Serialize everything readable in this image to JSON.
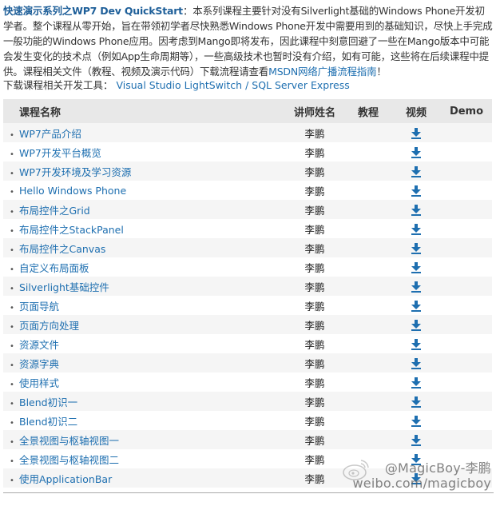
{
  "intro": {
    "lead_title": "快速演示系列之WP7 Dev QuickStart",
    "lead_colon": "：",
    "body": "本系列课程主要针对没有Silverlight基础的Windows Phone开发初学者。整个课程从零开始，旨在带领初学者尽快熟悉Windows Phone开发中需要用到的基础知识，尽快上手完成一般功能的Windows Phone应用。因考虑到Mango即将发布，因此课程中刻意回避了一些在Mango版本中可能会发生变化的技术点（例如App生命周期等），一些高级技术也暂时没有介绍，如有可能，这些将在后续课程中提供。课程相关文件（教程、视频及演示代码）下载流程请查看",
    "guide_link": "MSDN网络广播流程指南",
    "end_mark": "！"
  },
  "tools": {
    "label": "下载课程相关开发工具：",
    "link1": "Visual Studio LightSwitch",
    "separator": " / ",
    "link2": "SQL Server Express"
  },
  "table": {
    "headers": {
      "name": "课程名称",
      "lecturer": "讲师姓名",
      "tutorial": "教程",
      "video": "视频",
      "demo": "Demo"
    },
    "bullet": "•",
    "download_icon": "download-arrow-icon",
    "accent_color": "#1e6fb0",
    "rows": [
      {
        "name": "WP7产品介绍",
        "lecturer": "李鹏",
        "video": true
      },
      {
        "name": "WP7开发平台概览",
        "lecturer": "李鹏",
        "video": true
      },
      {
        "name": "WP7开发环境及学习资源",
        "lecturer": "李鹏",
        "video": true
      },
      {
        "name": "Hello Windows Phone",
        "lecturer": "李鹏",
        "video": true
      },
      {
        "name": "布局控件之Grid",
        "lecturer": "李鹏",
        "video": true
      },
      {
        "name": "布局控件之StackPanel",
        "lecturer": "李鹏",
        "video": true
      },
      {
        "name": "布局控件之Canvas",
        "lecturer": "李鹏",
        "video": true
      },
      {
        "name": "自定义布局面板",
        "lecturer": "李鹏",
        "video": true
      },
      {
        "name": "Silverlight基础控件",
        "lecturer": "李鹏",
        "video": true
      },
      {
        "name": "页面导航",
        "lecturer": "李鹏",
        "video": true
      },
      {
        "name": "页面方向处理",
        "lecturer": "李鹏",
        "video": true
      },
      {
        "name": "资源文件",
        "lecturer": "李鹏",
        "video": true
      },
      {
        "name": "资源字典",
        "lecturer": "李鹏",
        "video": true
      },
      {
        "name": "使用样式",
        "lecturer": "李鹏",
        "video": true
      },
      {
        "name": "Blend初识一",
        "lecturer": "李鹏",
        "video": true
      },
      {
        "name": "Blend初识二",
        "lecturer": "李鹏",
        "video": true
      },
      {
        "name": "全景视图与枢轴视图一",
        "lecturer": "李鹏",
        "video": true
      },
      {
        "name": "全景视图与枢轴视图二",
        "lecturer": "李鹏",
        "video": true
      },
      {
        "name": "使用ApplicationBar",
        "lecturer": "李鹏",
        "video": true
      }
    ]
  },
  "watermark": {
    "handle": "@MagicBoy-李鹏",
    "url": "weibo.com/magicboy"
  }
}
